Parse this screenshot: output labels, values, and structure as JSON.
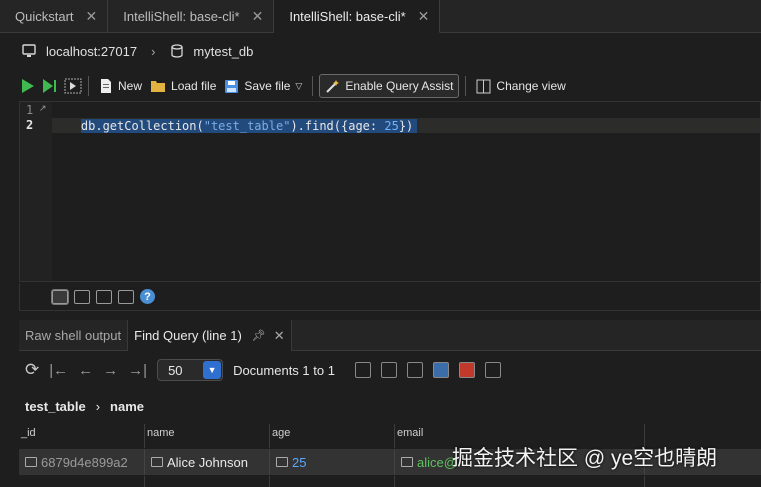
{
  "tabs": [
    {
      "label": "Quickstart"
    },
    {
      "label": "IntelliShell: base-cli*"
    },
    {
      "label": "IntelliShell: base-cli*"
    }
  ],
  "connection": {
    "host": "localhost:27017",
    "database": "mytest_db"
  },
  "toolbar": {
    "new_label": "New",
    "load_label": "Load file",
    "save_label": "Save file",
    "assist_label": "Enable Query Assist",
    "view_label": "Change view"
  },
  "editor": {
    "line_numbers": [
      "1",
      "2"
    ],
    "code_prefix": "db.getCollection(",
    "code_string": "\"test_table\"",
    "code_mid": ").find({age: ",
    "code_number": "25",
    "code_suffix": "})"
  },
  "results_tabs": [
    {
      "label": "Raw shell output"
    },
    {
      "label": "Find Query (line 1)"
    }
  ],
  "results": {
    "page_size": "50",
    "documents_label": "Documents 1 to 1",
    "collection": "test_table",
    "view": "name"
  },
  "table": {
    "columns": [
      "_id",
      "name",
      "age",
      "email"
    ],
    "rows": [
      {
        "_id": "6879d4e899a2",
        "name": "Alice Johnson",
        "age": "25",
        "email": "alice@"
      }
    ]
  },
  "watermark": "掘金技术社区 @ ye空也晴朗",
  "colors": {
    "selection": "#234a7c",
    "accent": "#2f6fd0",
    "string": "#7aaee8"
  }
}
